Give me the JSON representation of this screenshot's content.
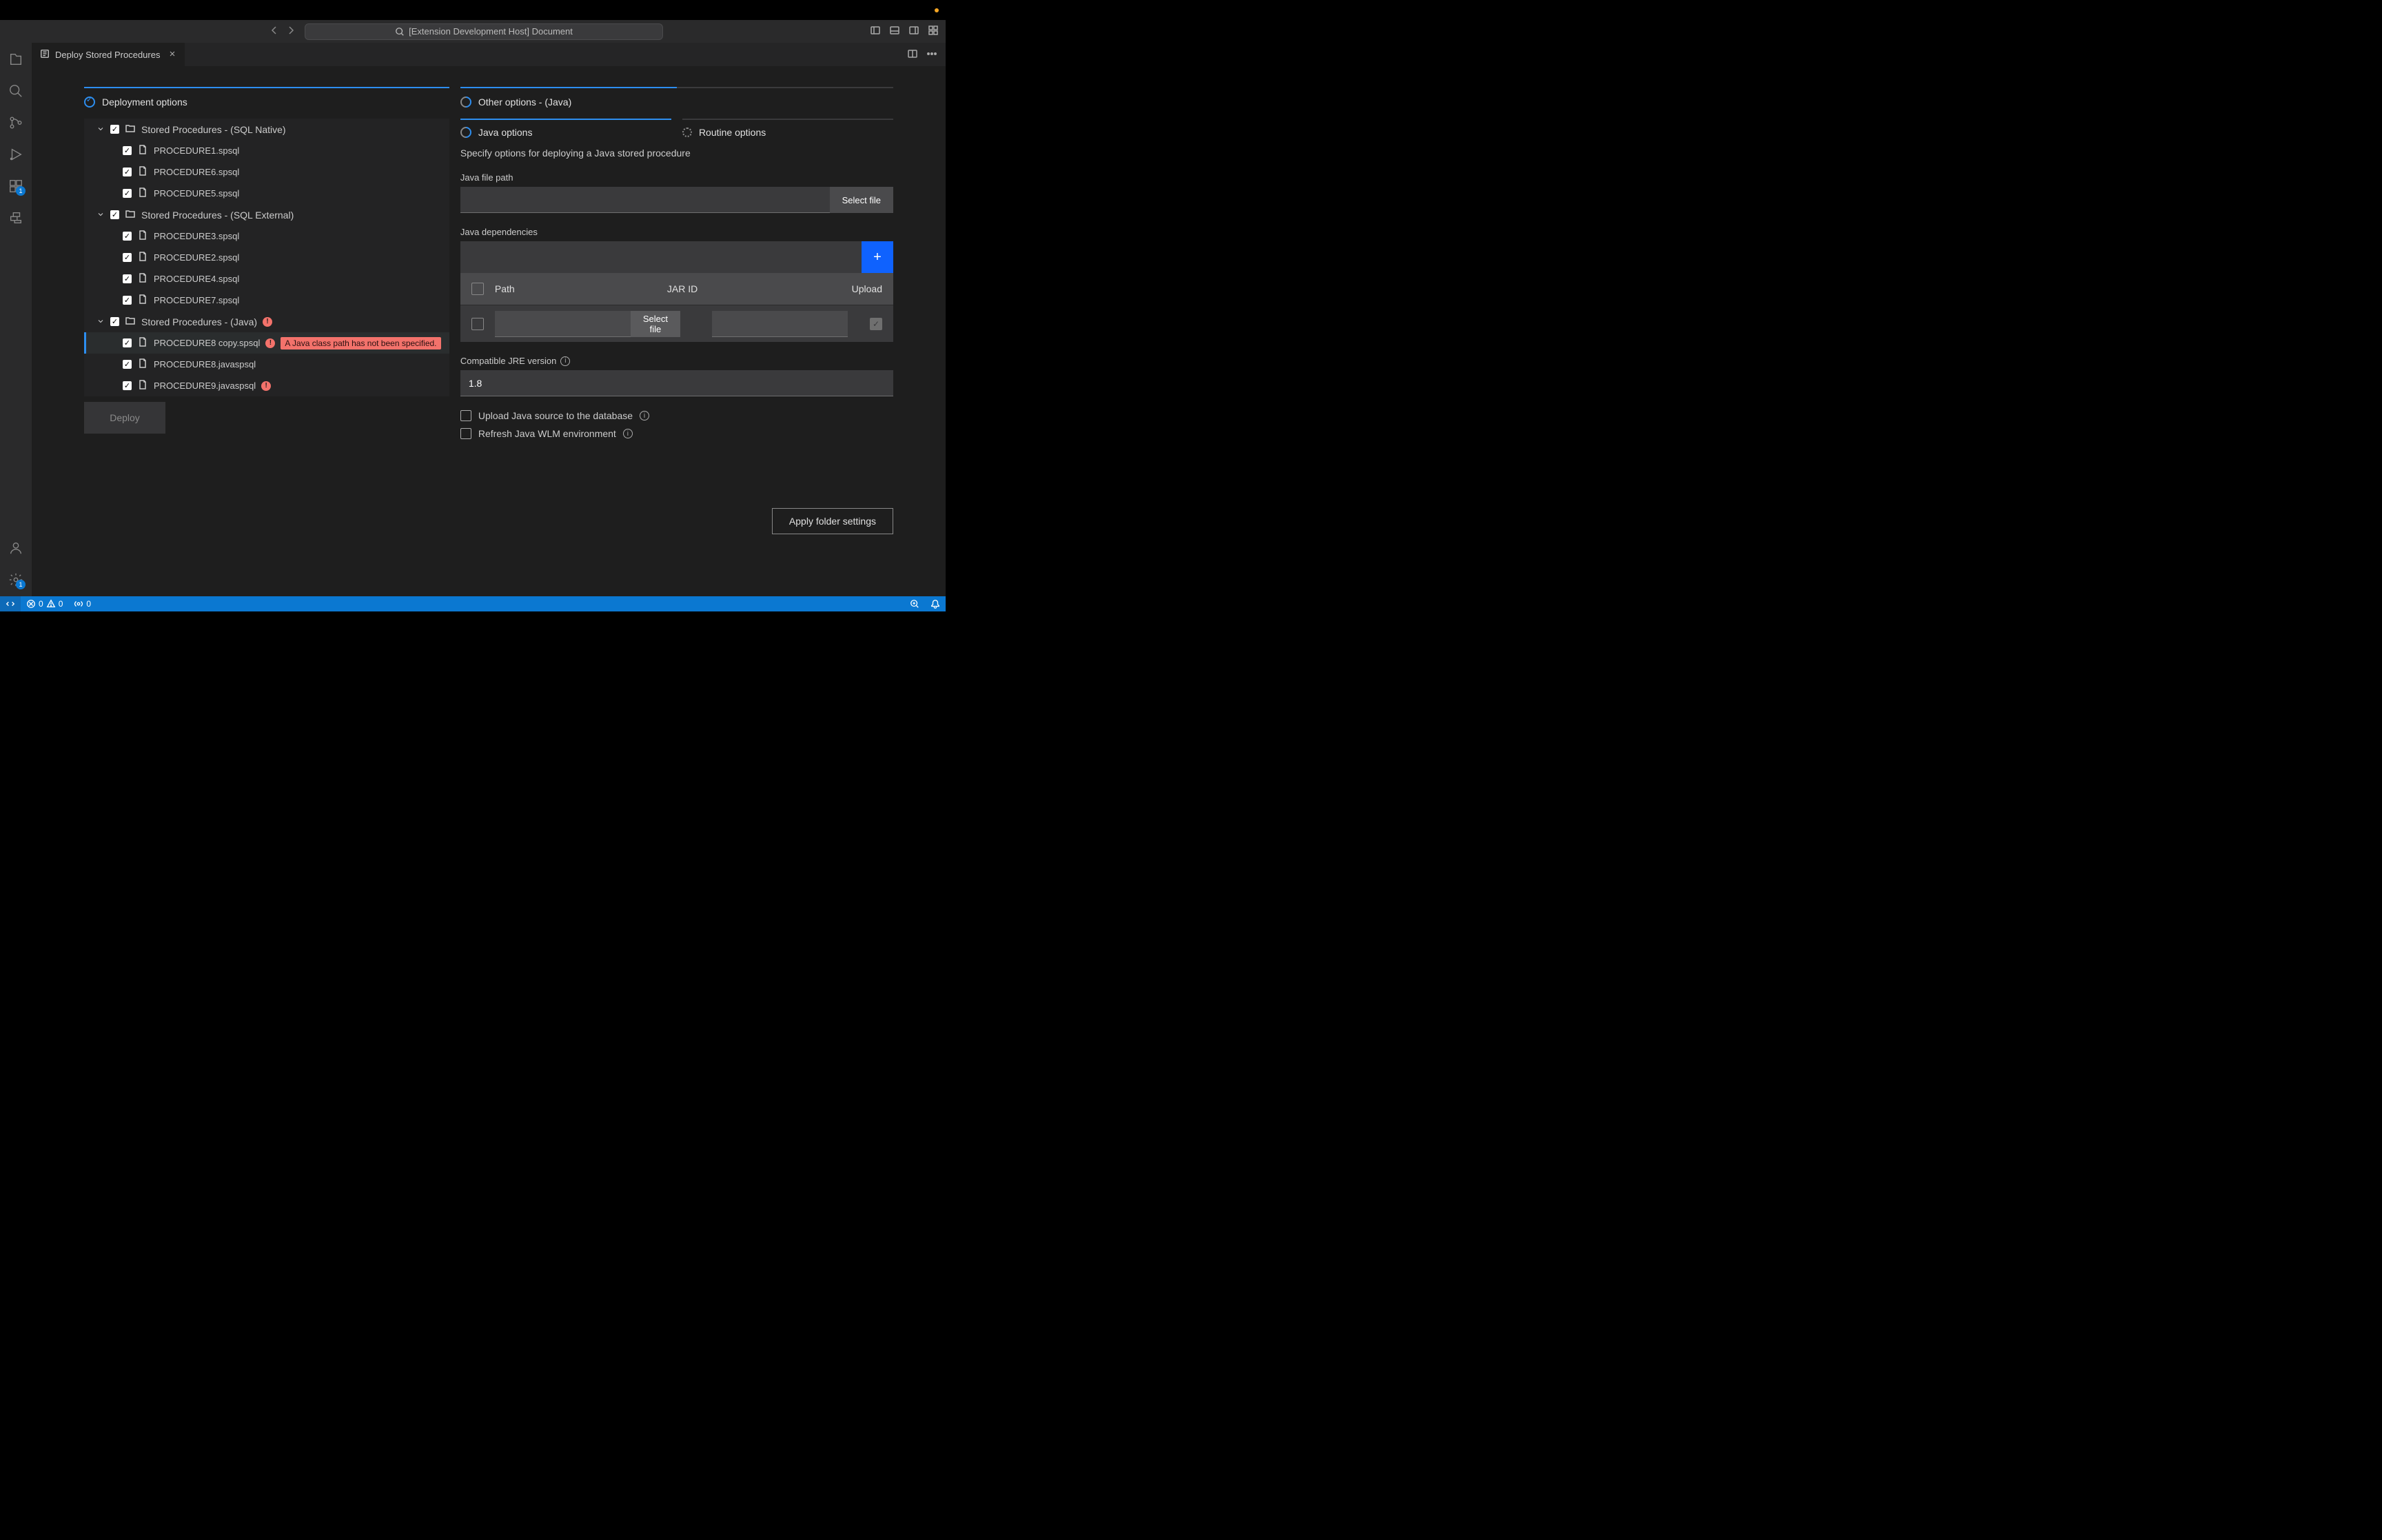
{
  "titlebar": {
    "command_center": "[Extension Development Host] Document"
  },
  "tab": {
    "title": "Deploy Stored Procedures"
  },
  "left": {
    "section": "Deployment options",
    "groups": [
      {
        "name": "Stored Procedures - (SQL Native)",
        "error": false,
        "items": [
          {
            "name": "PROCEDURE1.spsql",
            "error": false
          },
          {
            "name": "PROCEDURE6.spsql",
            "error": false
          },
          {
            "name": "PROCEDURE5.spsql",
            "error": false
          }
        ]
      },
      {
        "name": "Stored Procedures - (SQL External)",
        "error": false,
        "items": [
          {
            "name": "PROCEDURE3.spsql",
            "error": false
          },
          {
            "name": "PROCEDURE2.spsql",
            "error": false
          },
          {
            "name": "PROCEDURE4.spsql",
            "error": false
          },
          {
            "name": "PROCEDURE7.spsql",
            "error": false
          }
        ]
      },
      {
        "name": "Stored Procedures - (Java)",
        "error": true,
        "items": [
          {
            "name": "PROCEDURE8 copy.spsql",
            "error": true,
            "selected": true,
            "banner": "A Java class path has not been specified."
          },
          {
            "name": "PROCEDURE8.javaspsql",
            "error": false
          },
          {
            "name": "PROCEDURE9.javaspsql",
            "error": true
          }
        ]
      }
    ],
    "deploy_label": "Deploy"
  },
  "right": {
    "section": "Other options - (Java)",
    "subtabs": {
      "java": "Java options",
      "routine": "Routine options"
    },
    "desc": "Specify options for deploying a Java stored procedure",
    "java_path_label": "Java file path",
    "select_file": "Select file",
    "deps_label": "Java dependencies",
    "table": {
      "path": "Path",
      "jar": "JAR ID",
      "upload": "Upload"
    },
    "jre_label": "Compatible JRE version",
    "jre_value": "1.8",
    "upload_source": "Upload Java source to the database",
    "refresh_wlm": "Refresh Java WLM environment",
    "apply": "Apply folder settings"
  },
  "status": {
    "errors": "0",
    "warnings": "0",
    "ports": "0"
  },
  "activitybar": {
    "ext_badge": "1",
    "settings_badge": "1"
  }
}
